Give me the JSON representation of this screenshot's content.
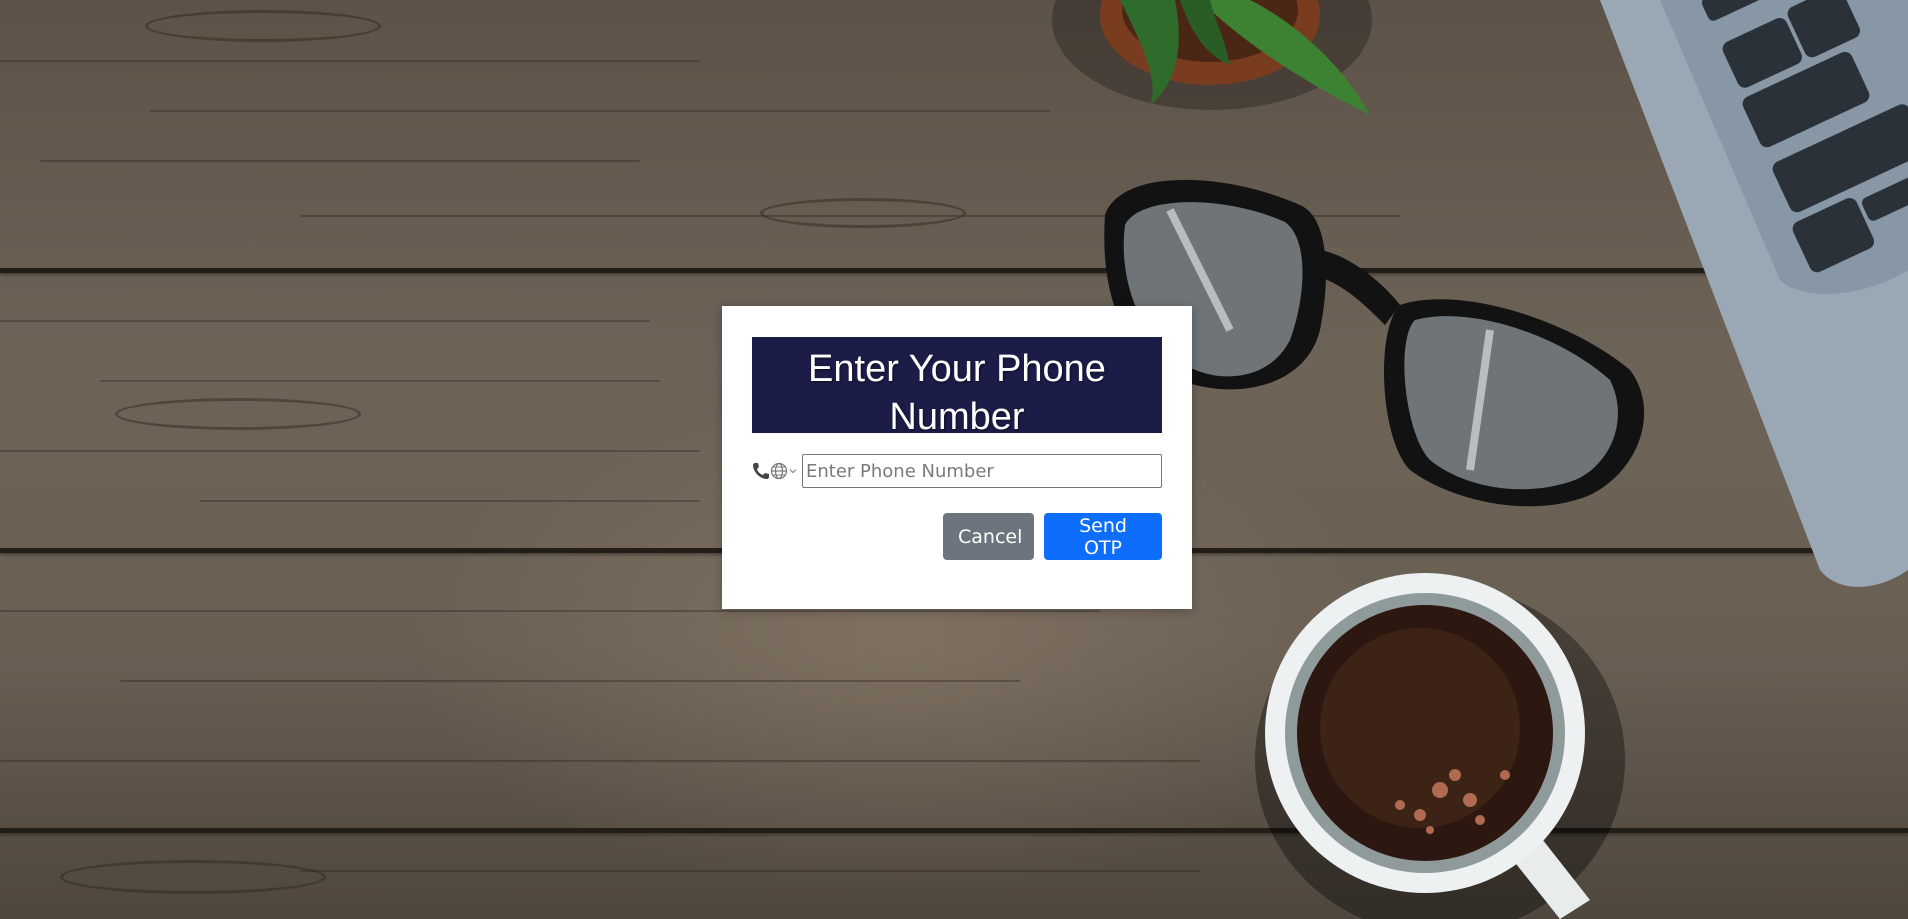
{
  "modal": {
    "title": "Enter Your Phone Number",
    "phone_input": {
      "placeholder": "Enter Phone Number",
      "value": ""
    },
    "country_picker": {
      "icons": [
        "phone-icon",
        "globe-icon",
        "chevron-down-icon"
      ]
    },
    "buttons": {
      "cancel_label": "Cancel",
      "send_label": "Send OTP"
    }
  },
  "colors": {
    "title_background": "#1c1c48",
    "cancel_button": "#6c757d",
    "send_button": "#0d6efd",
    "page_background": "#6a5f53"
  }
}
